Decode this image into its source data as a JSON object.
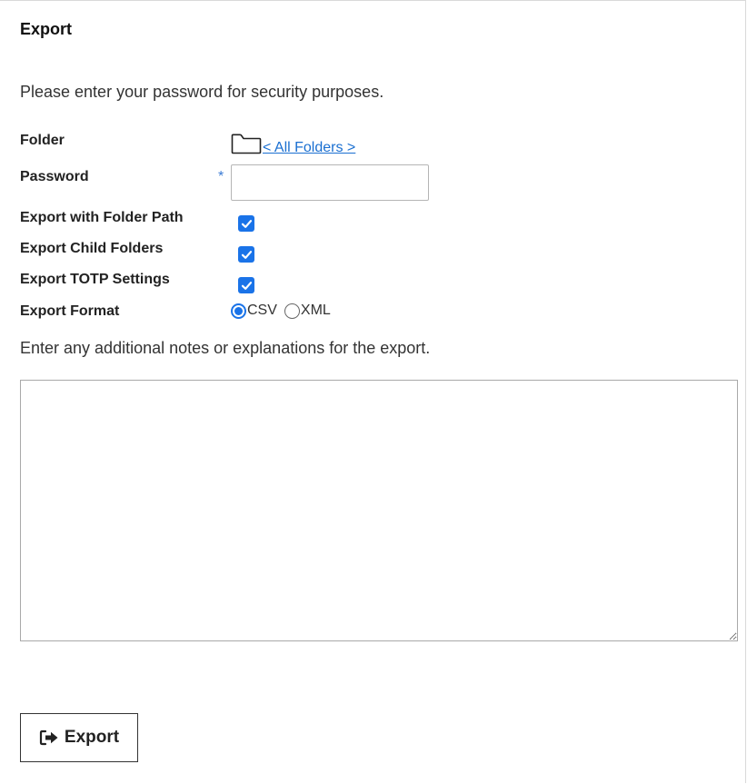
{
  "panel": {
    "title": "Export"
  },
  "intro_text": "Please enter your password for security purposes.",
  "form": {
    "folder_label": "Folder",
    "folder_link": "< All Folders >",
    "password_label": "Password",
    "password_required_marker": "*",
    "password_value": "",
    "export_folder_path_label": "Export with Folder Path",
    "export_folder_path_checked": true,
    "export_child_folders_label": "Export Child Folders",
    "export_child_folders_checked": true,
    "export_totp_label": "Export TOTP Settings",
    "export_totp_checked": true,
    "export_format_label": "Export Format",
    "format_options": [
      {
        "label": "CSV",
        "selected": true
      },
      {
        "label": "XML",
        "selected": false
      }
    ]
  },
  "notes": {
    "label": "Enter any additional notes or explanations for the export.",
    "value": ""
  },
  "export_button": {
    "label": "Export",
    "icon": "sign-out-icon"
  },
  "colors": {
    "accent": "#1a73e8",
    "link": "#1a6fd1",
    "required": "#3a7bd5"
  }
}
